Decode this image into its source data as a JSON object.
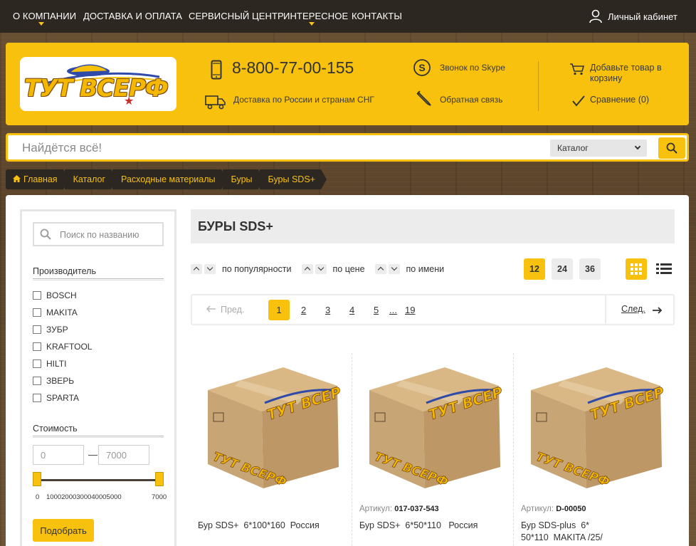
{
  "topnav": {
    "items": [
      "О КОМПАНИИ",
      "ДОСТАВКА И ОПЛАТА",
      "СЕРВИСНЫЙ ЦЕНТР",
      "ИНТЕРЕСНОЕ",
      "КОНТАКТЫ"
    ],
    "account_label": "Личный кабинет"
  },
  "header": {
    "logo_text": "ТУТ ВСЕРФ",
    "phone": "8-800-77-00-155",
    "delivery": "Доставка по России и странам СНГ",
    "skype": "Звонок по Skype",
    "feedback": "Обратная связь",
    "cart": [
      "Добавьте товар в",
      "корзину"
    ],
    "compare": "Сравнение (0)"
  },
  "search": {
    "placeholder": "Найдётся всё!",
    "category": "Каталог"
  },
  "breadcrumb": [
    "Главная",
    "Каталог",
    "Расходные материалы",
    "Буры",
    "Буры SDS+"
  ],
  "sidebar": {
    "search_placeholder": "Поиск по названию",
    "manufacturer_title": "Производитель",
    "brands": [
      "BOSCH",
      "MAKITA",
      "ЗУБР",
      "KRAFTOOL",
      "HILTI",
      "ЗВЕРЬ",
      "SPARTA"
    ],
    "price_title": "Стоимость",
    "price_min": "0",
    "price_dash": "—",
    "price_max": "7000",
    "slider_min_label": "0",
    "slider_ticks": "10002000300040005000",
    "slider_max_label": "7000",
    "apply_label": "Подобрать"
  },
  "main": {
    "title": "БУРЫ SDS+",
    "sort": [
      "по популярности",
      "по цене",
      "по имени"
    ],
    "per_page": [
      "12",
      "24",
      "36"
    ],
    "per_page_selected": "12",
    "pager": {
      "prev": "Пред.",
      "pages": [
        "1",
        "2",
        "3",
        "4",
        "5",
        "...",
        "19"
      ],
      "current": "1",
      "next": "След."
    },
    "products": [
      {
        "sku_label": "",
        "sku": "",
        "name": "Бур SDS+  6*100*160  Россия"
      },
      {
        "sku_label": "Артикул:",
        "sku": "017-037-543",
        "name": "Бур SDS+  6*50*110   Россия"
      },
      {
        "sku_label": "Артикул:",
        "sku": "D-00050",
        "name": "Бур SDS-plus  6*\n50*110  MAKITA /25/"
      }
    ]
  },
  "colors": {
    "accent": "#f7c10d",
    "dark": "#2d2721"
  },
  "icons": [
    "chevron-down-icon",
    "user-icon",
    "phone-icon",
    "truck-icon",
    "skype-icon",
    "pencil-icon",
    "cart-icon",
    "check-icon",
    "search-icon",
    "home-icon",
    "grid-view-icon",
    "list-view-icon",
    "arrow-left-icon",
    "arrow-right-icon"
  ]
}
